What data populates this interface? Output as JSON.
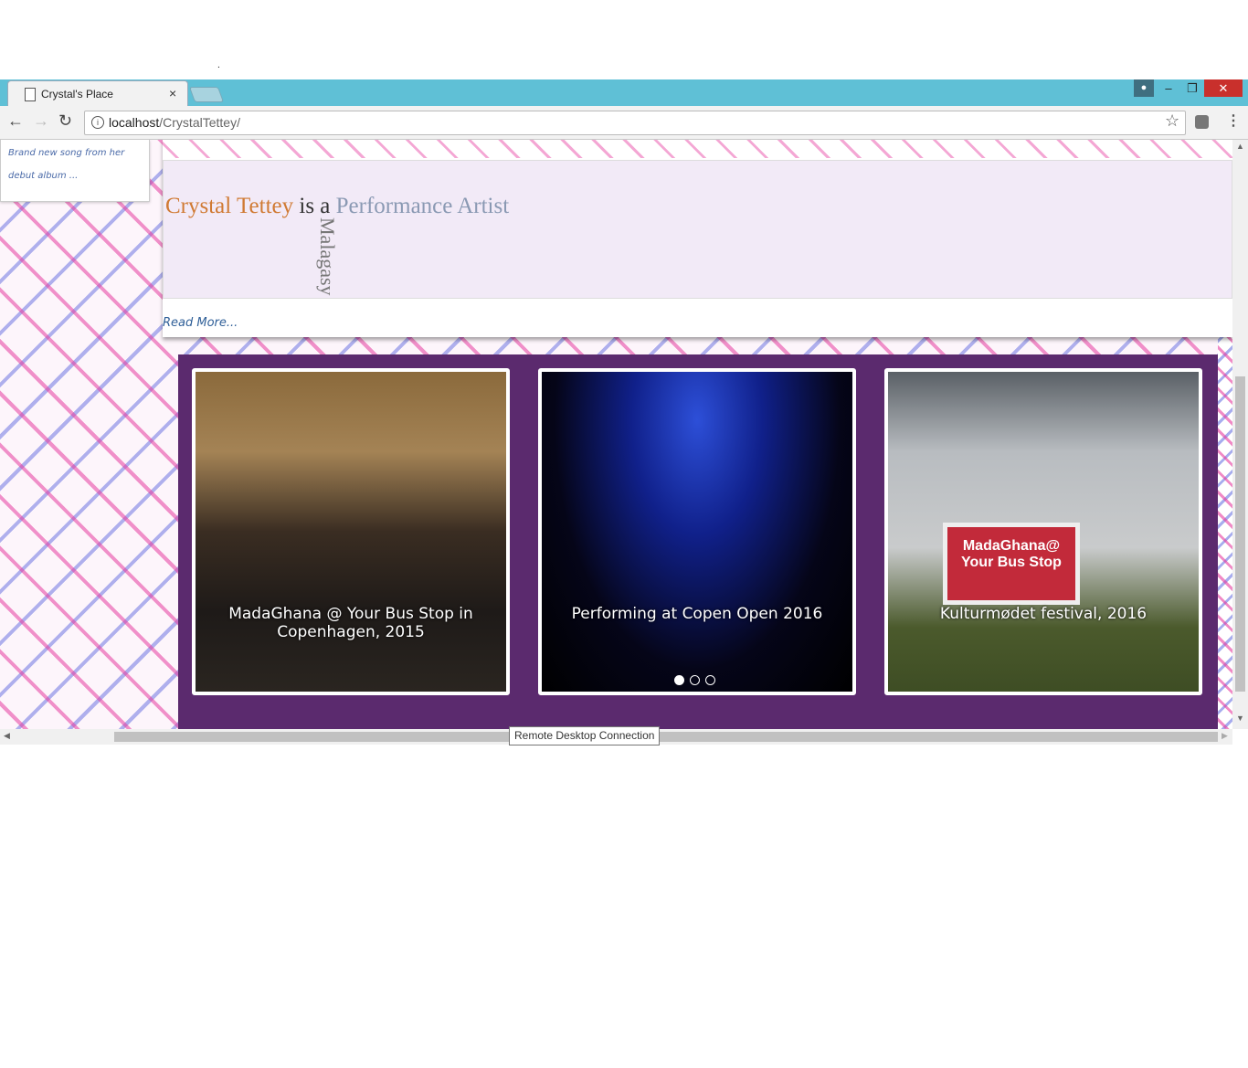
{
  "top_marker": ".",
  "browser": {
    "tab_title": "Crystal's Place",
    "tab_close": "×",
    "url_host": "localhost",
    "url_path": "/CrystalTettey/",
    "win_min": "–",
    "win_max": "❐",
    "win_close": "✕"
  },
  "sidebar": {
    "text": "Brand new song from her debut album ..."
  },
  "intro": {
    "name": "Crystal Tettey",
    "connector": "is a",
    "role": "Performance Artist",
    "rotated_word": "Malagasy",
    "read_more": "Read More..."
  },
  "gallery": {
    "slides": [
      {
        "caption": "MadaGhana @ Your Bus Stop in Copenhagen, 2015"
      },
      {
        "caption": "Performing at Copen Open 2016"
      },
      {
        "caption": "Kulturmødet festival, 2016",
        "banner": "MadaGhana@ Your Bus Stop"
      }
    ],
    "active_dot": 0,
    "dot_count": 3
  },
  "tooltip": "Remote Desktop Connection",
  "colors": {
    "tab_bar": "#5fc0d6",
    "gallery_bg": "#5b2a6e",
    "intro_name": "#d07a33",
    "intro_role": "#8a99b3",
    "intro_bg": "#f2eaf7",
    "read_more": "#2f5f98"
  }
}
